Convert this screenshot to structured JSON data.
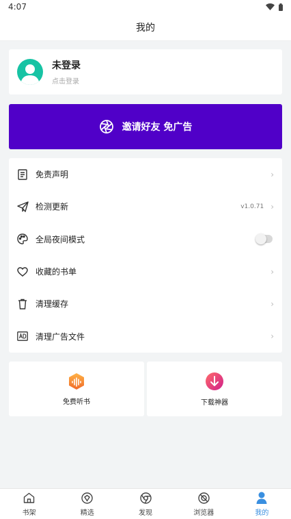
{
  "status_bar": {
    "time": "4:07"
  },
  "header": {
    "title": "我的"
  },
  "profile": {
    "name": "未登录",
    "subtitle": "点击登录"
  },
  "invite": {
    "label": "邀请好友 免广告"
  },
  "menu": {
    "items": [
      {
        "label": "免责声明",
        "icon": "document-icon"
      },
      {
        "label": "检测更新",
        "icon": "paper-plane-icon",
        "value": "v1.0.71"
      },
      {
        "label": "全局夜间模式",
        "icon": "palette-icon",
        "toggle": false
      },
      {
        "label": "收藏的书单",
        "icon": "heart-icon"
      },
      {
        "label": "清理缓存",
        "icon": "trash-icon"
      },
      {
        "label": "清理广告文件",
        "icon": "ad-icon"
      }
    ]
  },
  "tools": [
    {
      "label": "免费听书",
      "icon": "audiobook-icon"
    },
    {
      "label": "下载神器",
      "icon": "download-icon"
    }
  ],
  "bottom_nav": {
    "items": [
      {
        "label": "书架",
        "icon": "home-icon"
      },
      {
        "label": "精选",
        "icon": "featured-icon"
      },
      {
        "label": "发现",
        "icon": "discover-icon"
      },
      {
        "label": "浏览器",
        "icon": "browser-icon"
      },
      {
        "label": "我的",
        "icon": "profile-icon",
        "active": true
      }
    ]
  },
  "colors": {
    "accent": "#3a8fe0",
    "invite_bg": "#5000c8",
    "avatar_bg": "#17c3a4",
    "page_bg": "#f2f4f5"
  }
}
